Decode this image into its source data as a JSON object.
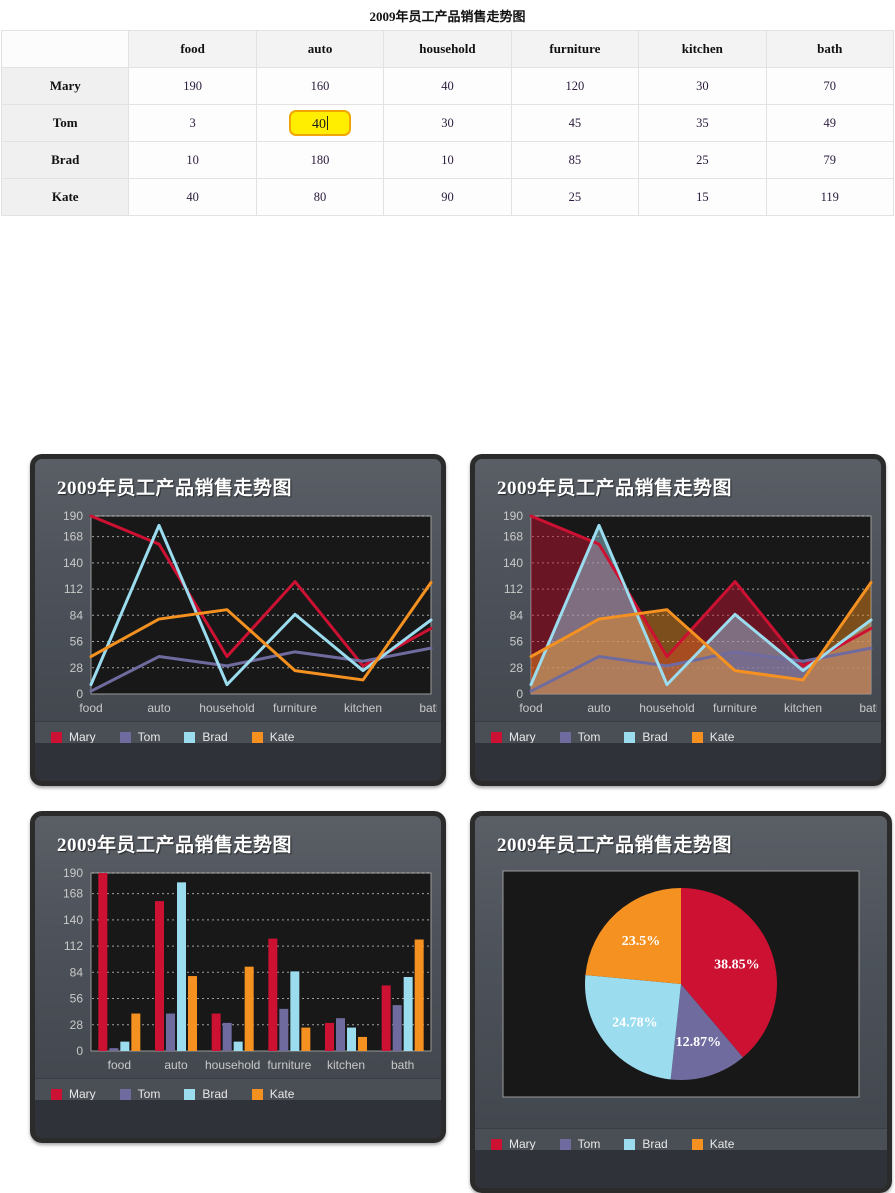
{
  "page": {
    "title": "2009年员工产品销售走势图"
  },
  "table": {
    "corner_label": "",
    "columns": [
      "food",
      "auto",
      "household",
      "furniture",
      "kitchen",
      "bath"
    ],
    "rows": [
      {
        "name": "Mary",
        "values": [
          "190",
          "160",
          "40",
          "120",
          "30",
          "70"
        ]
      },
      {
        "name": "Tom",
        "values": [
          "3",
          "40",
          "30",
          "45",
          "35",
          "49"
        ]
      },
      {
        "name": "Brad",
        "values": [
          "10",
          "180",
          "10",
          "85",
          "25",
          "79"
        ]
      },
      {
        "name": "Kate",
        "values": [
          "40",
          "80",
          "90",
          "25",
          "15",
          "119"
        ]
      }
    ],
    "editing_cell": {
      "row": 1,
      "col": 1,
      "value": "40"
    }
  },
  "series_colors": {
    "Mary": "#cc1133",
    "Tom": "#6f6b9e",
    "Brad": "#9bdcef",
    "Kate": "#f59120"
  },
  "legend": [
    {
      "label": "Mary",
      "color": "#cc1133"
    },
    {
      "label": "Tom",
      "color": "#6f6b9e"
    },
    {
      "label": "Brad",
      "color": "#9bdcef"
    },
    {
      "label": "Kate",
      "color": "#f59120"
    }
  ],
  "panels": [
    {
      "id": "line",
      "title": "2009年员工产品销售走势图"
    },
    {
      "id": "area",
      "title": "2009年员工产品销售走势图"
    },
    {
      "id": "bar",
      "title": "2009年员工产品销售走势图"
    },
    {
      "id": "pie",
      "title": "2009年员工产品销售走势图"
    }
  ],
  "chart_data": [
    {
      "type": "line",
      "title": "2009年员工产品销售走势图",
      "categories": [
        "food",
        "auto",
        "household",
        "furniture",
        "kitchen",
        "bath"
      ],
      "series": [
        {
          "name": "Mary",
          "color": "#cc1133",
          "values": [
            190,
            160,
            40,
            120,
            30,
            70
          ]
        },
        {
          "name": "Tom",
          "color": "#6f6b9e",
          "values": [
            3,
            40,
            30,
            45,
            35,
            49
          ]
        },
        {
          "name": "Brad",
          "color": "#9bdcef",
          "values": [
            10,
            180,
            10,
            85,
            25,
            79
          ]
        },
        {
          "name": "Kate",
          "color": "#f59120",
          "values": [
            40,
            80,
            90,
            25,
            15,
            119
          ]
        }
      ],
      "yticks": [
        0,
        28,
        56,
        84,
        112,
        140,
        168,
        190
      ],
      "ylim": [
        0,
        190
      ],
      "xlabel": "",
      "ylabel": "",
      "grid": true,
      "legend_position": "bottom"
    },
    {
      "type": "area",
      "title": "2009年员工产品销售走势图",
      "categories": [
        "food",
        "auto",
        "household",
        "furniture",
        "kitchen",
        "bath"
      ],
      "series": [
        {
          "name": "Mary",
          "color": "#cc1133",
          "values": [
            190,
            160,
            40,
            120,
            30,
            70
          ]
        },
        {
          "name": "Tom",
          "color": "#6f6b9e",
          "values": [
            3,
            40,
            30,
            45,
            35,
            49
          ]
        },
        {
          "name": "Brad",
          "color": "#9bdcef",
          "values": [
            10,
            180,
            10,
            85,
            25,
            79
          ]
        },
        {
          "name": "Kate",
          "color": "#f59120",
          "values": [
            40,
            80,
            90,
            25,
            15,
            119
          ]
        }
      ],
      "yticks": [
        0,
        28,
        56,
        84,
        112,
        140,
        168,
        190
      ],
      "ylim": [
        0,
        190
      ],
      "xlabel": "",
      "ylabel": "",
      "grid": true,
      "legend_position": "bottom"
    },
    {
      "type": "bar",
      "title": "2009年员工产品销售走势图",
      "categories": [
        "food",
        "auto",
        "household",
        "furniture",
        "kitchen",
        "bath"
      ],
      "series": [
        {
          "name": "Mary",
          "color": "#cc1133",
          "values": [
            190,
            160,
            40,
            120,
            30,
            70
          ]
        },
        {
          "name": "Tom",
          "color": "#6f6b9e",
          "values": [
            3,
            40,
            30,
            45,
            35,
            49
          ]
        },
        {
          "name": "Brad",
          "color": "#9bdcef",
          "values": [
            10,
            180,
            10,
            85,
            25,
            79
          ]
        },
        {
          "name": "Kate",
          "color": "#f59120",
          "values": [
            40,
            80,
            90,
            25,
            15,
            119
          ]
        }
      ],
      "yticks": [
        0,
        28,
        56,
        84,
        112,
        140,
        168,
        190
      ],
      "ylim": [
        0,
        190
      ],
      "xlabel": "",
      "ylabel": "",
      "grid": true,
      "legend_position": "bottom"
    },
    {
      "type": "pie",
      "title": "2009年员工产品销售走势图",
      "slices": [
        {
          "name": "Mary",
          "color": "#cc1133",
          "percent": 38.85,
          "label": "38.85%"
        },
        {
          "name": "Tom",
          "color": "#6f6b9e",
          "percent": 12.87,
          "label": "12.87%"
        },
        {
          "name": "Brad",
          "color": "#9bdcef",
          "percent": 24.78,
          "label": "24.78%"
        },
        {
          "name": "Kate",
          "color": "#f59120",
          "percent": 23.5,
          "label": "23.5%"
        }
      ],
      "legend_position": "bottom"
    }
  ]
}
